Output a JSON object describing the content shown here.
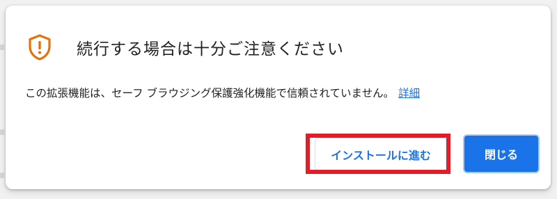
{
  "dialog": {
    "title": "続行する場合は十分ご注意ください",
    "message": "この拡張機能は、セーフ ブラウジング保護強化機能で信頼されていません。",
    "detail_link": "詳細",
    "install_button": "インストールに進む",
    "close_button": "閉じる",
    "warning_icon": "shield-exclamation-icon",
    "warning_color": "#e8710a",
    "link_color": "#1a73e8",
    "primary_color": "#1a73e8",
    "highlight_color": "#e11d2a"
  }
}
